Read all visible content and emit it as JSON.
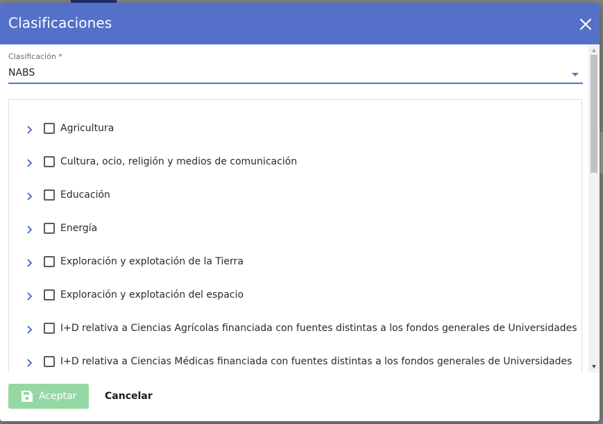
{
  "dialog": {
    "title": "Clasificaciones",
    "header_color": "#5570c8",
    "close_icon": "close-icon"
  },
  "field": {
    "label": "Clasificación *",
    "value": "NABS"
  },
  "tree": {
    "items": [
      {
        "label": "Agricultura"
      },
      {
        "label": "Cultura, ocio, religión y medios de comunicación"
      },
      {
        "label": "Educación"
      },
      {
        "label": "Energía"
      },
      {
        "label": "Exploración y explotación de la Tierra"
      },
      {
        "label": "Exploración y explotación del espacio"
      },
      {
        "label": "I+D relativa a Ciencias Agrícolas financiada con fuentes distintas a los fondos generales de Universidades"
      },
      {
        "label": "I+D relativa a Ciencias Médicas financiada con fuentes distintas a los fondos generales de Universidades"
      }
    ]
  },
  "footer": {
    "accept_label": "Aceptar",
    "accept_icon": "save-icon",
    "accept_color": "#95d8a4",
    "cancel_label": "Cancelar"
  }
}
